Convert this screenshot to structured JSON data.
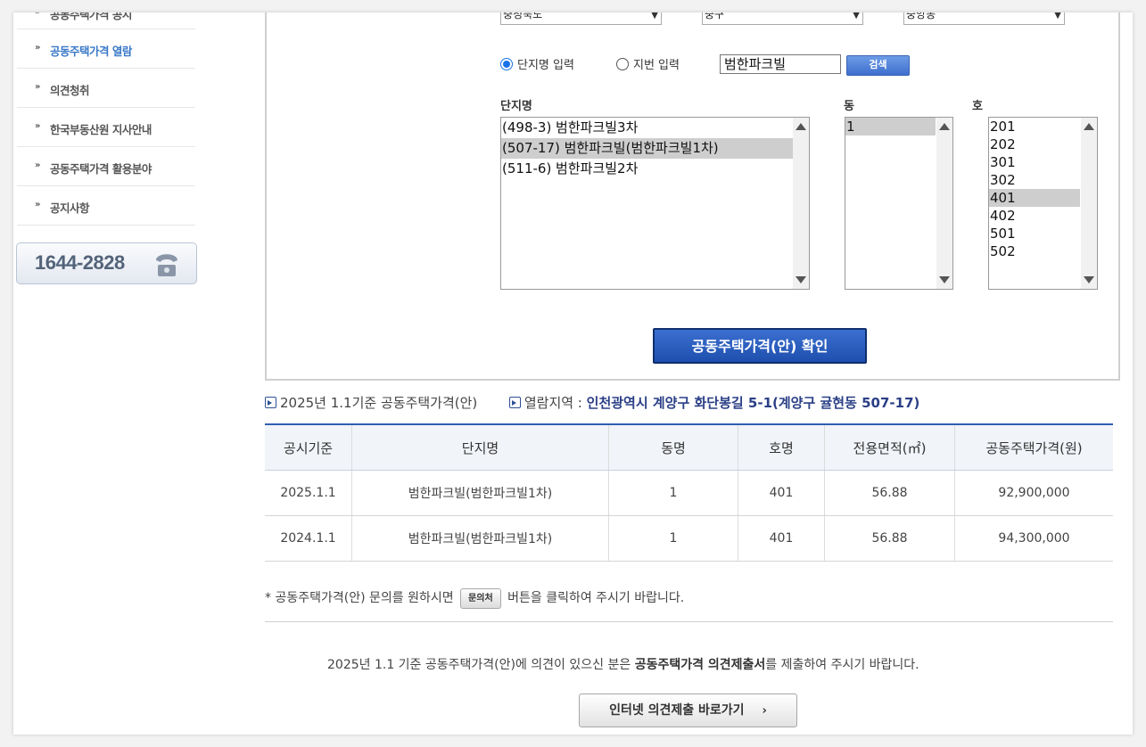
{
  "sidebar": {
    "items": [
      {
        "label": "공동주택가격 공시"
      },
      {
        "label": "공동주택가격 열람"
      },
      {
        "label": "의견청취"
      },
      {
        "label": "한국부동산원 지사안내"
      },
      {
        "label": "공동주택가격 활용분야"
      },
      {
        "label": "공지사항"
      }
    ],
    "active_index": 1,
    "phone": "1644-2828",
    "phone_icon": "telephone-icon"
  },
  "search": {
    "region_selects": [
      "충청북도",
      "중구",
      "중앙동"
    ],
    "radio_name": "단지명 입력",
    "radio_lot": "지번 입력",
    "selected_radio": "name",
    "query": "범한파크빌",
    "search_label": "검색",
    "complex_label": "단지명",
    "dong_label": "동",
    "ho_label": "호",
    "complexes": [
      {
        "text": "(498-3) 범한파크빌3차",
        "selected": false
      },
      {
        "text": "(507-17) 범한파크빌(범한파크빌1차)",
        "selected": true
      },
      {
        "text": "(511-6) 범한파크빌2차",
        "selected": false
      }
    ],
    "dongs": [
      {
        "text": "1",
        "selected": true
      }
    ],
    "hos": [
      {
        "text": "201",
        "selected": false
      },
      {
        "text": "202",
        "selected": false
      },
      {
        "text": "301",
        "selected": false
      },
      {
        "text": "302",
        "selected": false
      },
      {
        "text": "401",
        "selected": true
      },
      {
        "text": "402",
        "selected": false
      },
      {
        "text": "501",
        "selected": false
      },
      {
        "text": "502",
        "selected": false
      }
    ],
    "confirm_label": "공동주택가격(안) 확인"
  },
  "info": {
    "basis": "2025년 1.1기준 공동주택가격(안)",
    "area_label": "열람지역 :",
    "area_value": "인천광역시 계양구 화단봉길 5-1(계양구 귤현동 507-17)"
  },
  "table": {
    "headers": [
      "공시기준",
      "단지명",
      "동명",
      "호명",
      "전용면적(㎡)",
      "공동주택가격(원)"
    ],
    "rows": [
      [
        "2025.1.1",
        "범한파크빌(범한파크빌1차)",
        "1",
        "401",
        "56.88",
        "92,900,000"
      ],
      [
        "2024.1.1",
        "범한파크빌(범한파크빌1차)",
        "1",
        "401",
        "56.88",
        "94,300,000"
      ]
    ]
  },
  "note": {
    "prefix": "* 공동주택가격(안) 문의를 원하시면",
    "button": "문의처",
    "suffix": "버튼을 클릭하여 주시기 바랍니다."
  },
  "submit": {
    "prefix": "2025년 1.1 기준 공동주택가격(안)에 의견이 있으신 분은",
    "bold": "공동주택가격 의견제출서",
    "suffix": "를 제출하여 주시기 바랍니다.",
    "button": "인터넷 의견제출 바로가기",
    "button_icon": "chevron-right-icon"
  }
}
